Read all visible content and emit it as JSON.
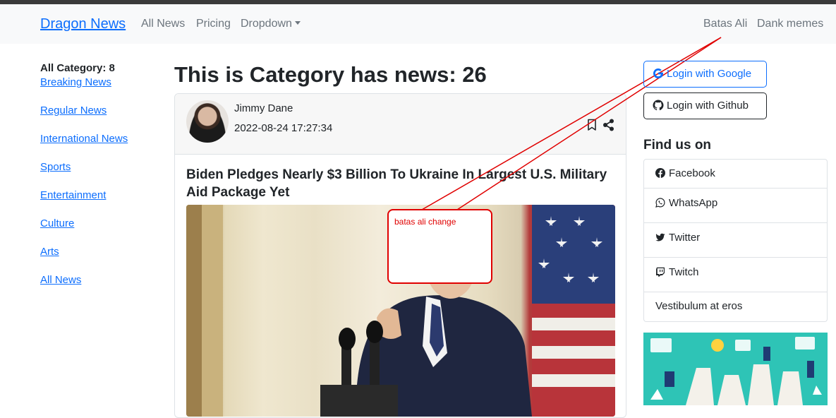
{
  "navbar": {
    "brand": "Dragon News",
    "links": [
      "All News",
      "Pricing",
      "Dropdown"
    ],
    "right_links": [
      "Batas Ali",
      "Dank memes"
    ]
  },
  "sidebar": {
    "count_label": "All Category: 8",
    "categories": [
      "Breaking News",
      "Regular News",
      "International News",
      "Sports",
      "Entertainment",
      "Culture",
      "Arts",
      "All News"
    ]
  },
  "main": {
    "heading": "This is Category has news: 26",
    "card": {
      "author_name": "Jimmy Dane",
      "published": "2022-08-24 17:27:34",
      "title": "Biden Pledges Nearly $3 Billion To Ukraine In Largest U.S. Military Aid Package Yet",
      "bookmark_icon": "bookmark-icon",
      "share_icon": "share-icon"
    }
  },
  "annotation": {
    "text": "batas ali change",
    "color": "#e00000"
  },
  "rightbar": {
    "login_google": "Login with Google",
    "login_github": "Login with Github",
    "find_title": "Find us on",
    "social": [
      {
        "label": "Facebook",
        "icon": "facebook-icon"
      },
      {
        "label": "WhatsApp",
        "icon": "whatsapp-icon"
      },
      {
        "label": "Twitter",
        "icon": "twitter-icon"
      },
      {
        "label": "Twitch",
        "icon": "twitch-icon"
      },
      {
        "label": "Vestibulum at eros",
        "icon": ""
      }
    ]
  },
  "colors": {
    "link": "#0d6efd",
    "muted": "#6c757d",
    "navbar_bg": "#f8f9fa"
  }
}
